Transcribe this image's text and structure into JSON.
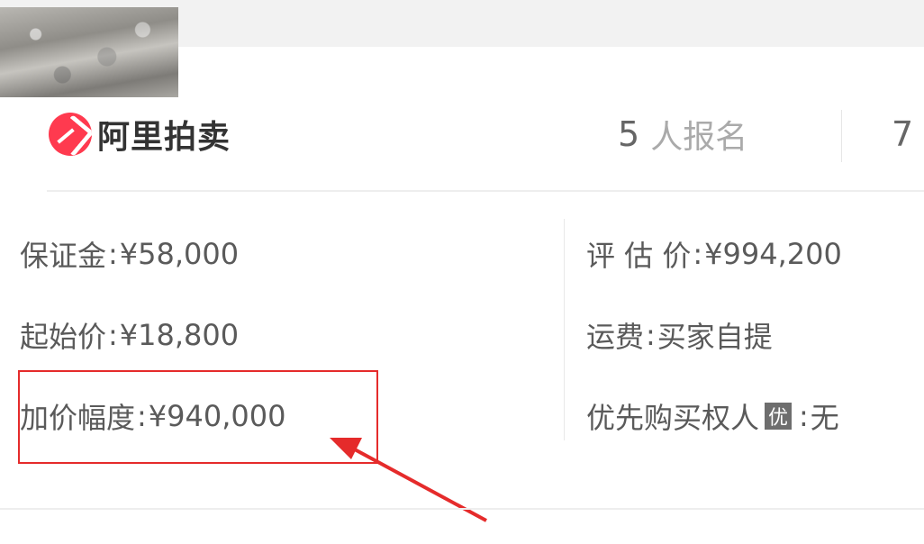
{
  "brand": {
    "name": "阿里拍卖",
    "icon": "ali-auction-logo-icon",
    "color": "#ff3a4f"
  },
  "stats": {
    "signup_count": "5",
    "signup_label": "人报名",
    "next_value": "7"
  },
  "details": {
    "deposit_label": "保证金",
    "deposit_value": "¥58,000",
    "start_price_label": "起始价",
    "start_price_value": "¥18,800",
    "increment_label": "加价幅度",
    "increment_value": "¥940,000",
    "appraisal_label": "评 估 价",
    "appraisal_value": "¥994,200",
    "shipping_label": "运费",
    "shipping_value": "买家自提",
    "priority_label": "优先购买权人",
    "priority_badge": "优",
    "priority_value": "无"
  },
  "annotation": {
    "box_color": "#e52b2b",
    "arrow_color": "#e52b2b"
  }
}
